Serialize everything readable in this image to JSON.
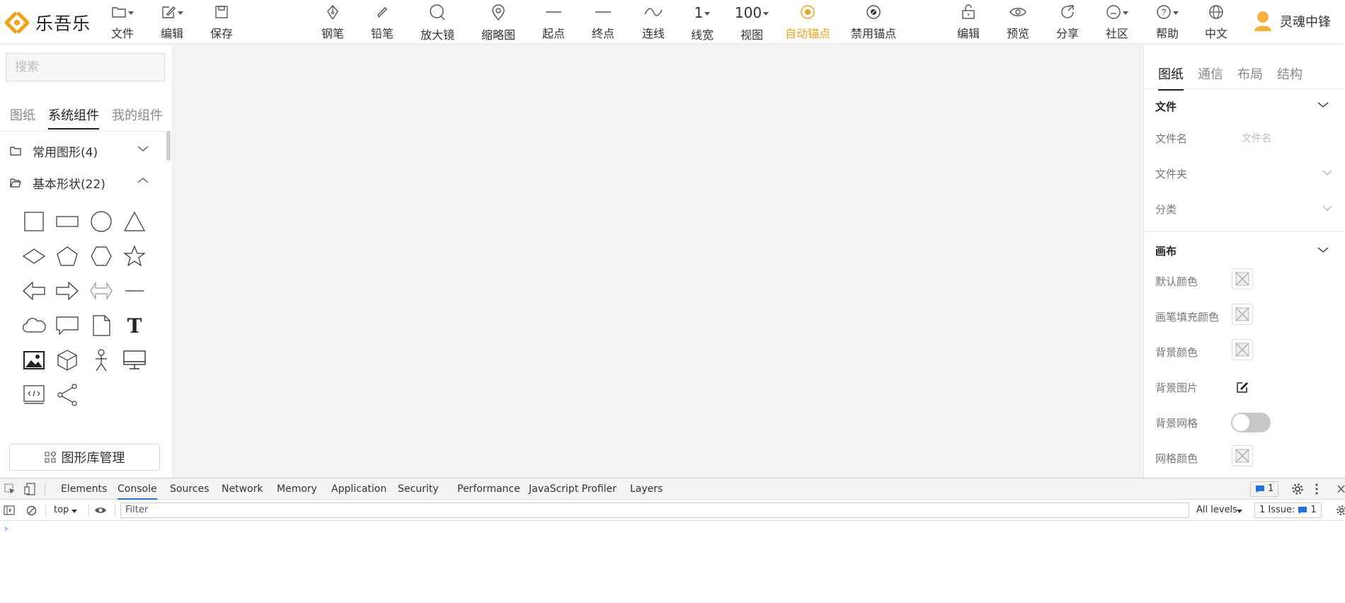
{
  "app": {
    "name": "乐吾乐",
    "accent": "#f5a012"
  },
  "toolbar": {
    "file": "文件",
    "edit": "编辑",
    "save": "保存",
    "pen": "钢笔",
    "pencil": "铅笔",
    "magnifier": "放大镜",
    "thumbnail": "缩略图",
    "start_point": "起点",
    "end_point": "终点",
    "connect_line": "连线",
    "line_width": "线宽",
    "line_width_value": "1",
    "view": "视图",
    "zoom_value": "100",
    "auto_anchor": "自动锚点",
    "disable_anchor": "禁用锚点",
    "edit_right": "编辑",
    "preview": "预览",
    "share": "分享",
    "community": "社区",
    "help": "帮助",
    "language": "中文"
  },
  "user": {
    "name": "灵魂中锋"
  },
  "left": {
    "search_placeholder": "搜索",
    "tabs": [
      "图纸",
      "系统组件",
      "我的组件"
    ],
    "active_tab": "系统组件",
    "groups": [
      {
        "label": "常用图形(4)",
        "expanded": false
      },
      {
        "label": "基本形状(22)",
        "expanded": true
      }
    ],
    "shape_icons": [
      "square-icon",
      "rectangle-icon",
      "circle-icon",
      "triangle-icon",
      "diamond-icon",
      "pentagon-icon",
      "hexagon-icon",
      "star-icon",
      "left-arrow-icon",
      "right-arrow-icon",
      "double-arrow-icon",
      "line-icon",
      "cloud-icon",
      "message-icon",
      "file-icon",
      "text-icon",
      "image-icon",
      "cube-icon",
      "people-icon",
      "computer-icon",
      "code-icon",
      "share-node-icon"
    ],
    "text_shape_label": "T",
    "library_button": "图形库管理"
  },
  "right": {
    "tabs": [
      "图纸",
      "通信",
      "布局",
      "结构"
    ],
    "active_tab": "图纸",
    "file_section": {
      "title": "文件",
      "filename_label": "文件名",
      "filename_placeholder": "文件名",
      "folder_label": "文件夹",
      "category_label": "分类"
    },
    "canvas_section": {
      "title": "画布",
      "default_color_label": "默认颜色",
      "pen_fill_color_label": "画笔填充颜色",
      "background_color_label": "背景颜色",
      "background_image_label": "背景图片",
      "background_grid_label": "背景网格",
      "background_grid_on": false,
      "grid_color_label": "网格颜色"
    }
  },
  "devtools": {
    "tabs": [
      "Elements",
      "Console",
      "Sources",
      "Network",
      "Memory",
      "Application",
      "Security",
      "Performance",
      "JavaScript Profiler",
      "Layers"
    ],
    "active_tab": "Console",
    "message_count": "1",
    "context": "top",
    "filter_placeholder": "Filter",
    "levels": "All levels",
    "issues_label": "1 Issue:",
    "issues_count": "1",
    "prompt": "›"
  }
}
